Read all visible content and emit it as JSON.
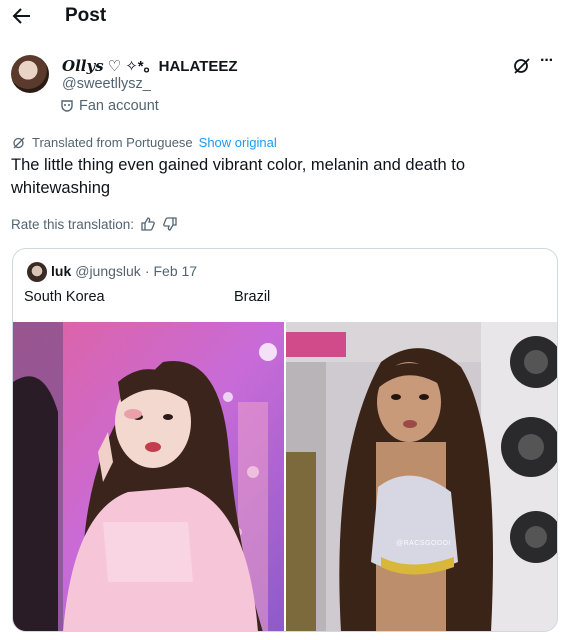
{
  "header": {
    "title": "Post",
    "back_icon": "arrow-left-icon"
  },
  "author": {
    "name_italic": "Ollys",
    "name_rest": "♡ ✧*。HALATEEZ",
    "handle": "@sweetllysz_",
    "badge_label": "Fan account",
    "badge_icon": "mask-icon"
  },
  "actions": {
    "grok_icon": "grok-icon",
    "more_icon": "more-icon"
  },
  "translation": {
    "label": "Translated from Portuguese",
    "show_original": "Show original",
    "rate_label": "Rate this translation:"
  },
  "tweet": {
    "text": "The little thing even gained vibrant color, melanin and death to whitewashing"
  },
  "quote": {
    "name": "luk",
    "handle": "@jungsluk",
    "separator": "·",
    "date": "Feb 17",
    "left_label": "South Korea",
    "right_label": "Brazil",
    "watermark": "@RACSGODOI"
  },
  "colors": {
    "link": "#1d9bf0",
    "muted": "#536471",
    "text": "#0f1419",
    "border": "#cfd9de"
  }
}
